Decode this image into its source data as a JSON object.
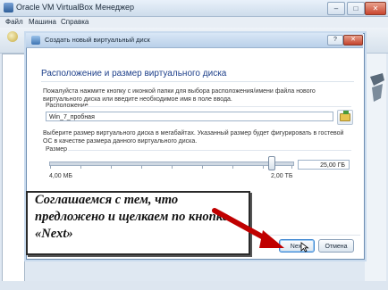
{
  "app": {
    "title": "Oracle VM VirtualBox Менеджер",
    "menu": [
      "Файл",
      "Машина",
      "Справка"
    ]
  },
  "dialog": {
    "title": "Создать новый виртуальный диск",
    "heading": "Расположение и размер виртуального диска",
    "location_desc": "Пожалуйста нажмите кнопку с иконкой папки для выбора расположения/имени файла нового виртуального диска или введите необходимое имя в поле ввода.",
    "location_label": "Расположение",
    "location_value": "Win_7_пробная",
    "size_desc": "Выберите размер виртуального диска в мегабайтах. Указанный размер будет фигурировать в гостевой ОС в качестве размера данного виртуального диска.",
    "size_label": "Размер",
    "size_value": "25,00 ГБ",
    "slider_min": "4,00 МБ",
    "slider_max": "2,00 ТБ",
    "slider_level": 0.91,
    "next_label": "Next",
    "cancel_label": "Отмена"
  },
  "callout": {
    "text": "Соглашаемся с тем, что предложено и щелкаем по кнопке «Next»"
  }
}
